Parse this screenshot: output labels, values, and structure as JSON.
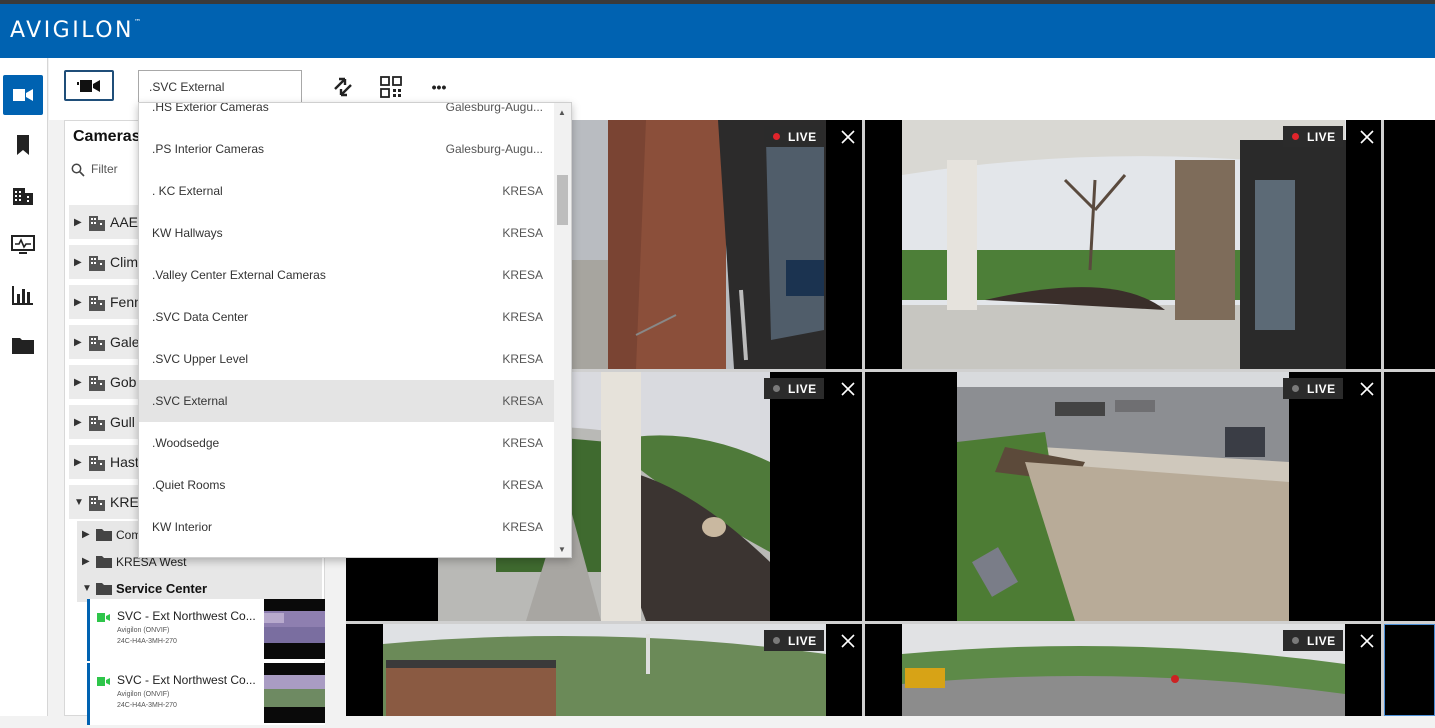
{
  "app": {
    "logo": "AVIGILON",
    "logo_tm": "™"
  },
  "nav": {
    "items": [
      {
        "name": "cameras-nav",
        "icon": "video-camera-icon",
        "active": true
      },
      {
        "name": "bookmarks-nav",
        "icon": "bookmark-icon",
        "active": false
      },
      {
        "name": "sites-nav",
        "icon": "building-icon",
        "active": false
      },
      {
        "name": "health-nav",
        "icon": "monitor-pulse-icon",
        "active": false
      },
      {
        "name": "reports-nav",
        "icon": "bar-chart-icon",
        "active": false
      },
      {
        "name": "files-nav",
        "icon": "folder-icon",
        "active": false
      }
    ]
  },
  "toolbar": {
    "view_value": ".SVC External",
    "icons": [
      "video-camera-icon",
      "sync-icon",
      "layout-grid-icon",
      "more-icon"
    ],
    "more_label": "•••"
  },
  "panel": {
    "title": "Cameras",
    "filter_placeholder": "Filter",
    "sites": [
      {
        "label": "AAE",
        "expanded": false
      },
      {
        "label": "Clim",
        "expanded": false
      },
      {
        "label": "Fenn",
        "expanded": false
      },
      {
        "label": "Gale",
        "expanded": false
      },
      {
        "label": "Gob",
        "expanded": false
      },
      {
        "label": "Gull",
        "expanded": false
      },
      {
        "label": "Hast",
        "expanded": false
      },
      {
        "label": "KRE",
        "expanded": true
      }
    ],
    "folders": [
      {
        "label": "Com",
        "bold": false
      },
      {
        "label": "KRESA West",
        "bold": false
      },
      {
        "label": "Service Center",
        "bold": true
      }
    ],
    "cameras": [
      {
        "name": "SVC - Ext Northwest Co...",
        "vendor": "Avigilon (ONVIF)",
        "model": "24C-H4A-3MH-270"
      },
      {
        "name": "SVC - Ext Northwest Co...",
        "vendor": "Avigilon (ONVIF)",
        "model": "24C-H4A-3MH-270"
      }
    ]
  },
  "dropdown": {
    "items": [
      {
        "name": ".HS Exterior Cameras",
        "site": "Galesburg-Augu...",
        "selected": false
      },
      {
        "name": ".PS Interior Cameras",
        "site": "Galesburg-Augu...",
        "selected": false
      },
      {
        "name": ". KC External",
        "site": "KRESA",
        "selected": false
      },
      {
        "name": "KW Hallways",
        "site": "KRESA",
        "selected": false
      },
      {
        "name": ".Valley Center External Cameras",
        "site": "KRESA",
        "selected": false
      },
      {
        "name": ".SVC Data Center",
        "site": "KRESA",
        "selected": false
      },
      {
        "name": ".SVC Upper Level",
        "site": "KRESA",
        "selected": false
      },
      {
        "name": ".SVC External",
        "site": "KRESA",
        "selected": true
      },
      {
        "name": ".Woodsedge",
        "site": "KRESA",
        "selected": false
      },
      {
        "name": ".Quiet Rooms",
        "site": "KRESA",
        "selected": false
      },
      {
        "name": "KW Interior",
        "site": "KRESA",
        "selected": false
      }
    ],
    "scroll_up": "▲",
    "scroll_down": "▼"
  },
  "tiles": [
    {
      "badge": "LIVE",
      "recording": true
    },
    {
      "badge": "LIVE",
      "recording": true
    },
    {
      "badge": "LIVE",
      "recording": false
    },
    {
      "badge": "LIVE",
      "recording": false
    },
    {
      "badge": "LIVE",
      "recording": false
    },
    {
      "badge": "LIVE",
      "recording": false
    }
  ],
  "colors": {
    "brand": "#0062b1",
    "recording_dot": "#e0242b",
    "idle_dot": "#7a7a7a",
    "camera_status": "#2ec54a"
  }
}
